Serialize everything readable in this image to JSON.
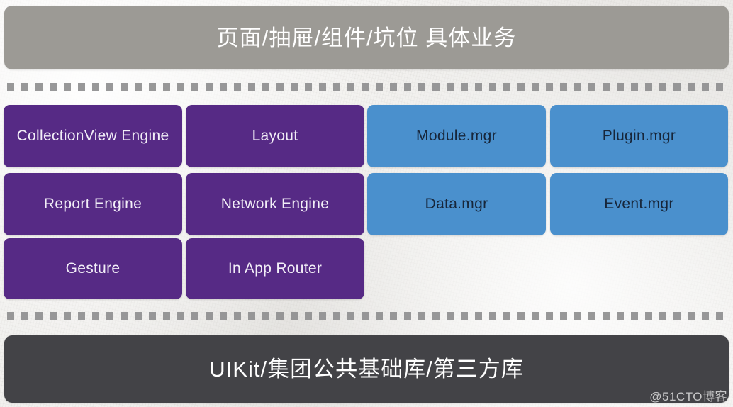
{
  "diagram": {
    "top_layer": {
      "label": "页面/抽屉/组件/坑位 具体业务",
      "color": "#9c9a95"
    },
    "bottom_layer": {
      "label": "UIKit/集团公共基础库/第三方库",
      "color": "#434347"
    },
    "separators": {
      "style": "dashed",
      "color": "#8f8f90"
    },
    "middle_layer": {
      "engine_color": "#562a85",
      "manager_color": "#4a90cd",
      "cards": [
        {
          "label": "CollectionView Engine",
          "group": "engine",
          "row": 1,
          "column": 1
        },
        {
          "label": "Layout",
          "group": "engine",
          "row": 1,
          "column": 2
        },
        {
          "label": "Module.mgr",
          "group": "manager",
          "row": 1,
          "column": 3
        },
        {
          "label": "Plugin.mgr",
          "group": "manager",
          "row": 1,
          "column": 4
        },
        {
          "label": "Report Engine",
          "group": "engine",
          "row": 2,
          "column": 1
        },
        {
          "label": "Network Engine",
          "group": "engine",
          "row": 2,
          "column": 2
        },
        {
          "label": "Data.mgr",
          "group": "manager",
          "row": 2,
          "column": 3
        },
        {
          "label": "Event.mgr",
          "group": "manager",
          "row": 2,
          "column": 4
        },
        {
          "label": "Gesture",
          "group": "engine",
          "row": 3,
          "column": 1
        },
        {
          "label": "In App Router",
          "group": "engine",
          "row": 3,
          "column": 2
        }
      ]
    }
  },
  "watermark": {
    "text": "@51CTO博客"
  }
}
